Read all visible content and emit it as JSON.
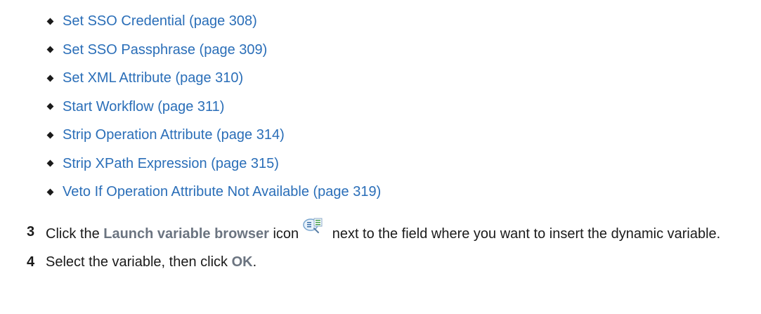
{
  "links": [
    {
      "label": "Set SSO Credential (page 308)"
    },
    {
      "label": "Set SSO Passphrase (page 309)"
    },
    {
      "label": "Set XML Attribute (page 310)"
    },
    {
      "label": "Start Workflow (page 311)"
    },
    {
      "label": "Strip Operation Attribute (page 314)"
    },
    {
      "label": "Strip XPath Expression (page 315)"
    },
    {
      "label": "Veto If Operation Attribute Not Available (page 319)"
    }
  ],
  "steps": [
    {
      "number": "3",
      "text_before": "Click the ",
      "ui_term": "Launch variable browser",
      "text_middle": " icon",
      "icon": "variable-browser-icon",
      "text_after": " next to the field where you want to insert the dynamic variable."
    },
    {
      "number": "4",
      "text_before": "Select the variable, then click ",
      "ui_term": "OK",
      "text_after": "."
    }
  ],
  "colors": {
    "link": "#2a6eb8",
    "ui_term": "#6b7480",
    "text": "#1a1a1a"
  }
}
